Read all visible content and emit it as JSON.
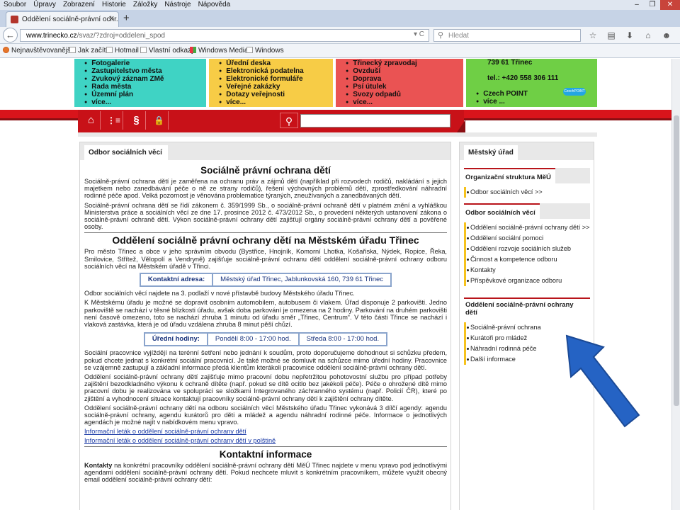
{
  "menu": [
    "Soubor",
    "Úpravy",
    "Zobrazení",
    "Historie",
    "Záložky",
    "Nástroje",
    "Nápověda"
  ],
  "window_controls": {
    "minimize": "–",
    "maximize": "❐",
    "close": "✕"
  },
  "tab": {
    "title": "Oddělení sociálně-právní ochr...",
    "close": "✕",
    "new": "+"
  },
  "url": {
    "domain": "www.trinecko.cz",
    "path": "/svaz/?zdroj=oddeleni_spod",
    "icons": "▾ C"
  },
  "search": {
    "placeholder": "Hledat",
    "glyph": "⚲"
  },
  "toolbar_icons": [
    "☆",
    "▤",
    "⬇",
    "⌂",
    "☻",
    "≡"
  ],
  "bookmarks": [
    "Nejnavštěvovanější",
    "Jak začít",
    "Hotmail",
    "Vlastní odkazy",
    "Windows Media",
    "Windows"
  ],
  "top_boxes": {
    "teal": [
      "Fotogalerie",
      "Zastupitelstvo města",
      "Zvukový záznam ZMě",
      "Rada města",
      "Územní plán",
      "více..."
    ],
    "yellow": [
      "Úřední deska",
      "Elektronická podatelna",
      "Elektronické formuláře",
      "Veřejné zakázky",
      "Dotazy veřejnosti",
      "více..."
    ],
    "red": [
      "Třinecký zpravodaj",
      "Ovzduší",
      "Doprava",
      "Psí útulek",
      "Svozy odpadů",
      "více..."
    ],
    "green_address": "739 61 Třinec",
    "green_phone": "tel.: +420 558 306 111",
    "green_items": [
      "Czech POINT",
      "více ..."
    ],
    "czech_logo": "CzechPOINT"
  },
  "tools": {
    "home": "⌂",
    "sitemap": "⋮≡",
    "law": "§",
    "lock": "🔒",
    "search": "⚲"
  },
  "main": {
    "tab": "Odbor sociálních věcí",
    "h1": "Sociálně právní ochrana dětí",
    "p1": "Sociálně-právní ochrana dětí je zaměřena na ochranu práv a zájmů dětí (například při rozvodech rodičů, nakládání s jejich majetkem nebo zanedbávání péče o ně ze strany rodičů), řešení výchovných problémů dětí, zprostředkování náhradní rodinné péče apod. Velká pozornost je věnována problematice týraných, zneužívaných a zanedbávaných dětí.",
    "p2": "Sociálně-právní ochrana dětí se řídí zákonem č. 359/1999 Sb., o sociálně-právní ochraně dětí v platném znění a vyhláškou Ministerstva práce a sociálních věcí ze dne 17. prosince 2012 č. 473/2012 Sb., o provedení některých ustanovení zákona o sociálně-právní ochraně dětí. Výkon sociálně-právní ochrany dětí zajišťují orgány sociálně-právní ochrany dětí a pověřené osoby.",
    "h2": "Oddělení sociálně právní ochrany dětí na Městském úřadu Třinec",
    "p3": "Pro město Třinec a obce v jeho správním obvodu (Bystřice, Hnojník, Komorní Lhotka, Košařiska, Nýdek, Ropice, Řeka, Smilovice, Střítež, Vělopolí a Vendryně) zajišťuje sociálně-právní ochranu dětí oddělení sociálně-právní ochrany odboru sociálních věcí na Městském úřadě v Třinci.",
    "contact_label": "Kontaktní adresa:",
    "contact_value": "Městský úřad Třinec, Jablunkovská 160, 739 61 Třinec",
    "p4": "Odbor sociálních věcí najdete na 3. podlaží v nové přístavbě budovy Městského úřadu Třinec.",
    "p5": "K Městskému úřadu je možné se dopravit osobním automobilem, autobusem či vlakem. Úřad disponuje 2 parkovišti. Jedno parkoviště se nachází v těsné blízkosti úřadu, avšak doba parkování je omezena na 2 hodiny. Parkování na druhém parkovišti není časově omezeno, toto se nachází zhruba 1 minutu od úřadu směr „Třinec, Centrum“. V této části Třince se nachází i vlaková zastávka, která je od úřadu vzdálena zhruba 8 minut pěší chůzí.",
    "hours_label": "Úřední hodiny:",
    "hours_mon": "Pondělí 8:00 - 17:00 hod.",
    "hours_wed": "Středa 8:00 - 17:00 hod.",
    "p6": "Sociální pracovnice vyjíždějí na terénní šetření nebo jednání k soudům, proto doporučujeme dohodnout si schůzku předem, pokud chcete jednat s konkrétní sociální pracovnicí. Je také možné se domluvit na schůzce mimo úřední hodiny. Pracovnice se vzájemně zastupují a základní informace předá klientům kterákoli pracovnice oddělení sociálně-právní ochrany dětí.",
    "p7": "Oddělení sociálně-právní ochrany dětí zajišťuje mimo pracovní dobu nepřetržitou pohotovostní službu pro případ potřeby zajištění bezodkladného výkonu k ochraně dítěte (např. pokud se dítě ocitlo bez jakékoli péče). Péče o ohrožené dítě mimo pracovní dobu je realizována ve spolupráci se složkami Integrovaného záchranného systému (např. Policií ČR), které po zjištění a vyhodnocení situace kontaktují pracovníky sociálně-právní ochrany dětí k zajištění ochrany dítěte.",
    "p8": "Oddělení sociálně-právní ochrany dětí na odboru sociálních věcí Městského úřadu Třinec vykonává 3 dílčí agendy: agendu sociálně-právní ochrany, agendu kurátorů pro děti a mládež a agendu náhradní rodinné péče. Informace o jednotlivých agendách je možné najít v nabídkovém menu vpravo.",
    "link1": "Informační leták o oddělení sociálně-právní ochrany dětí",
    "link2": "Informační leták o oddělení sociálně-právní ochrany dětí v polštině",
    "h3": "Kontaktní informace",
    "p9_bold": "Kontakty",
    "p9": " na konkrétní pracovníky oddělení sociálně-právní ochrany dětí MěÚ Třinec najdete v menu vpravo pod jednotlivými agendami oddělení sociálně-právní ochrany dětí. Pokud nechcete mluvit s konkrétním pracovníkem, můžete využít obecný email oddělení sociálně-právní ochrany dětí:"
  },
  "side": {
    "tab": "Městský úřad",
    "sec1_title": "Organizační struktura MěÚ",
    "sec1_items": [
      "Odbor sociálních věcí  >>"
    ],
    "sec2_title": "Odbor sociálních věcí",
    "sec2_items": [
      "Oddělení sociálně-právní ochrany dětí >>",
      "Oddělení sociální pomoci",
      "Oddělení rozvoje sociálních služeb",
      "Činnost a kompetence odboru",
      "Kontakty",
      "Příspěvkové organizace odboru"
    ],
    "sec3_title": "Oddělení sociálně-právní ochrany dětí",
    "sec3_items": [
      "Sociálně-právní ochrana",
      "Kurátoři pro mládež",
      "Náhradní rodinná péče",
      "Další informace"
    ]
  },
  "colors": {
    "teal": "#3fd3c4",
    "yellow": "#f7cc46",
    "red": "#ea5353",
    "green": "#6fcf45",
    "band": "#d9141b",
    "arrow": "#2563c4"
  }
}
